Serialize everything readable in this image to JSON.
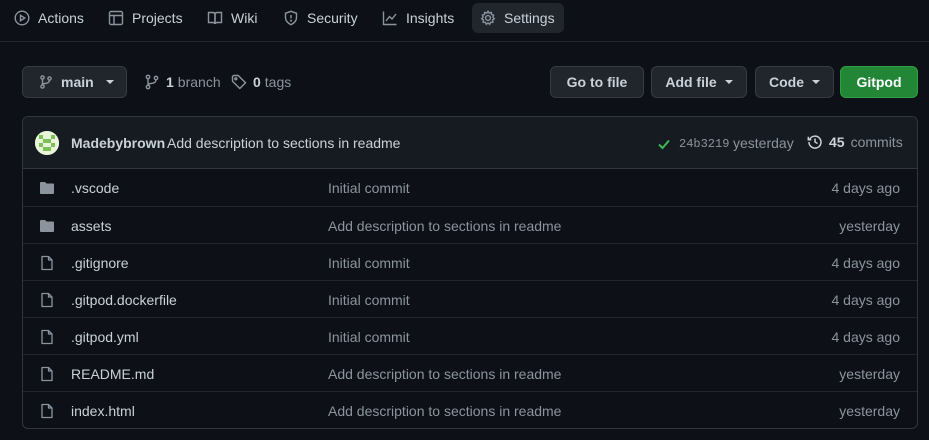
{
  "nav": {
    "items": [
      {
        "label": "Actions",
        "icon": "play-circle-icon"
      },
      {
        "label": "Projects",
        "icon": "table-icon"
      },
      {
        "label": "Wiki",
        "icon": "book-icon"
      },
      {
        "label": "Security",
        "icon": "shield-icon"
      },
      {
        "label": "Insights",
        "icon": "graph-icon"
      },
      {
        "label": "Settings",
        "icon": "gear-icon",
        "active": true
      }
    ]
  },
  "toolbar": {
    "branch_name": "main",
    "branch_count": "1",
    "branch_label": "branch",
    "tag_count": "0",
    "tag_label": "tags",
    "go_to_file": "Go to file",
    "add_file": "Add file",
    "code": "Code",
    "gitpod": "Gitpod"
  },
  "latest_commit": {
    "author": "Madebybrown",
    "message": "Add description to sections in readme",
    "sha": "24b3219",
    "when": "yesterday",
    "commit_count": "45",
    "commit_label": "commits",
    "status": "success"
  },
  "files": [
    {
      "name": ".vscode",
      "type": "folder",
      "message": "Initial commit",
      "age": "4 days ago"
    },
    {
      "name": "assets",
      "type": "folder",
      "message": "Add description to sections in readme",
      "age": "yesterday"
    },
    {
      "name": ".gitignore",
      "type": "file",
      "message": "Initial commit",
      "age": "4 days ago"
    },
    {
      "name": ".gitpod.dockerfile",
      "type": "file",
      "message": "Initial commit",
      "age": "4 days ago"
    },
    {
      "name": ".gitpod.yml",
      "type": "file",
      "message": "Initial commit",
      "age": "4 days ago"
    },
    {
      "name": "README.md",
      "type": "file",
      "message": "Add description to sections in readme",
      "age": "yesterday"
    },
    {
      "name": "index.html",
      "type": "file",
      "message": "Add description to sections in readme",
      "age": "yesterday"
    }
  ],
  "colors": {
    "background": "#0d1117",
    "primary_button": "#238636",
    "success": "#3fb950",
    "folder": "#8b949e"
  }
}
